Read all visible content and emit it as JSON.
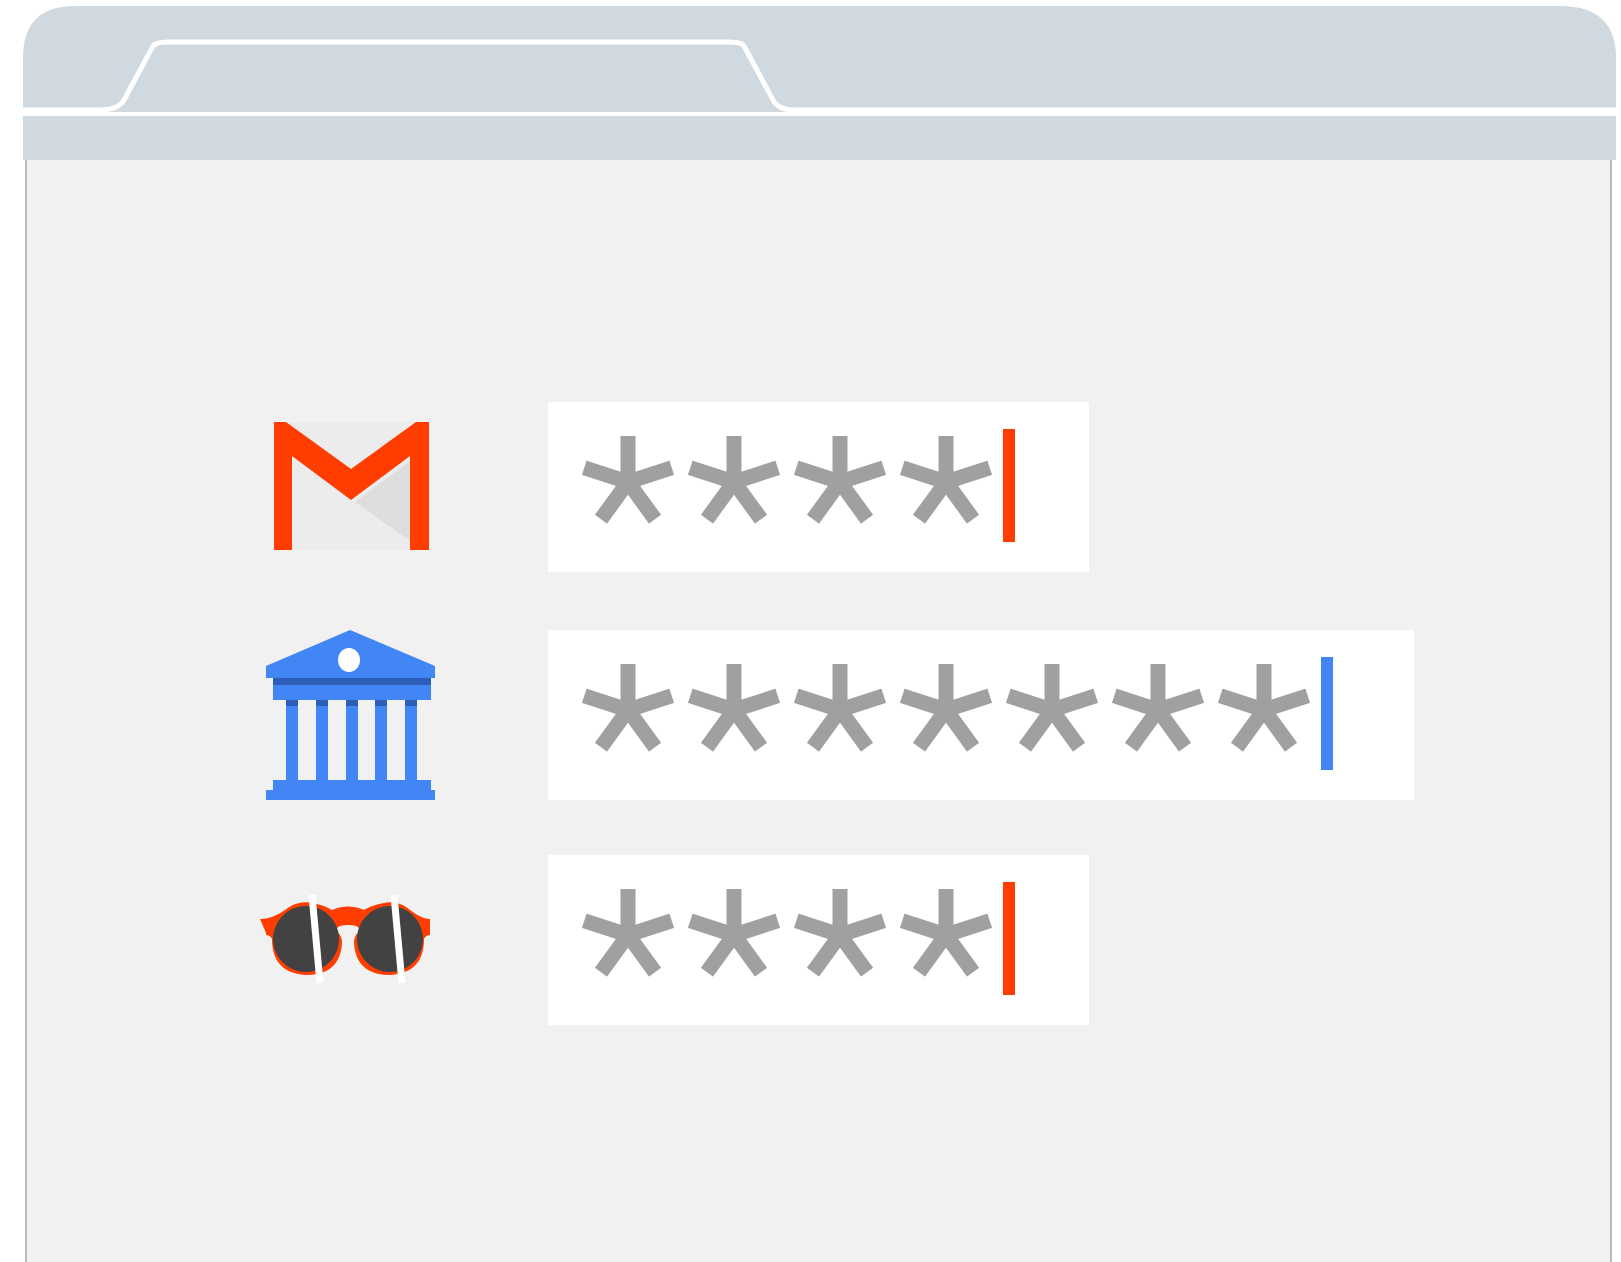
{
  "colors": {
    "frame": "#d0d9df",
    "content_background": "#f0f1f0",
    "frame_border": "#b9bbbb",
    "mask_glyph": "#a0a0a0",
    "cursor_red": "#ff3d00",
    "cursor_blue": "#4285f4",
    "field_background": "#ffffff"
  },
  "rows": [
    {
      "icon": "gmail-icon",
      "masked_characters": 4,
      "cursor_color": "#ff3d00"
    },
    {
      "icon": "bank-icon",
      "masked_characters": 7,
      "cursor_color": "#4285f4"
    },
    {
      "icon": "sunglasses-icon",
      "masked_characters": 4,
      "cursor_color": "#ff3d00"
    }
  ]
}
